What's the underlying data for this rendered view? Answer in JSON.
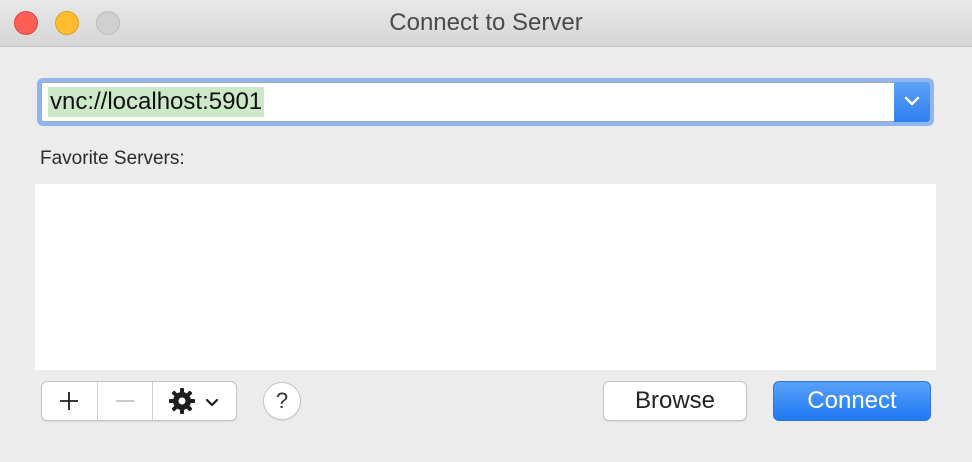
{
  "window": {
    "title": "Connect to Server"
  },
  "address": {
    "value": "vnc://localhost:5901"
  },
  "favorites": {
    "label": "Favorite Servers:",
    "items": []
  },
  "toolbar": {
    "add_icon": "plus-icon",
    "remove_icon": "minus-icon",
    "action_icon": "gear-icon",
    "help_label": "?",
    "browse_label": "Browse",
    "connect_label": "Connect"
  },
  "colors": {
    "accent": "#2e7ff0",
    "selection": "#cce8c8",
    "close": "#fd5f57",
    "minimize": "#febc2e",
    "zoom_disabled": "#d0d0d0"
  }
}
